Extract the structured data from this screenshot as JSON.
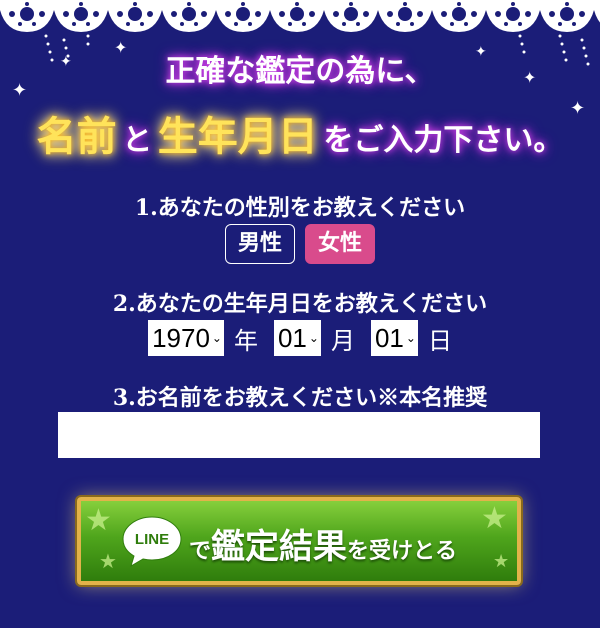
{
  "header": {
    "line1": "正確な鑑定の為に、",
    "name_word": "名前",
    "and_word": "と",
    "birth_word": "生年月日",
    "tail": "をご入力下さい。"
  },
  "question1": {
    "label": "1.あなたの性別をお教えください",
    "options": [
      "男性",
      "女性"
    ],
    "selected": "女性"
  },
  "question2": {
    "label": "2.あなたの生年月日をお教えください",
    "year": "1970",
    "year_unit": "年",
    "month": "01",
    "month_unit": "月",
    "day": "01",
    "day_unit": "日"
  },
  "question3": {
    "label": "3.お名前をお教えください※本名推奨",
    "value": ""
  },
  "cta": {
    "line_badge": "LINE",
    "de": "で",
    "big": "鑑定結果",
    "small": "を受けとる"
  },
  "colors": {
    "background": "#1b1d78",
    "female_selected": "#d94b8c",
    "cta_green": "#4fa51c",
    "cta_border": "#e2b34a",
    "headline_gold": "#ffe35a",
    "headline_glow": "#c13ce0"
  }
}
